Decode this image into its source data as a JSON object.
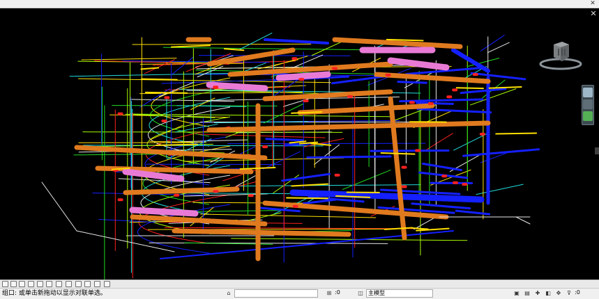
{
  "viewport": {
    "close_glyph": "✕",
    "pipe_colors": {
      "duct_orange": "#e07a1f",
      "duct_pink": "#e87ad6",
      "pipe_blue": "#1420ff",
      "pipe_yellow": "#ffe000",
      "pipe_green": "#22dd22",
      "pipe_cyan": "#22dddd",
      "pipe_white": "#e8e8e8",
      "pipe_red": "#ff2020",
      "pipe_lime": "#aaff00"
    }
  },
  "viewcube": {
    "icon": "viewcube-icon"
  },
  "navigation_bar": {
    "tools": [
      "steering-wheel-icon",
      "pan-icon",
      "zoom-icon"
    ]
  },
  "status_bar": {
    "message": "组口: 或单击新拖动以显示对联单选。",
    "coord_value": ":0",
    "model_name": "主模型",
    "filter_value": ":0"
  },
  "colors": {
    "chrome": "#f0f0f0",
    "canvas": "#000000"
  }
}
